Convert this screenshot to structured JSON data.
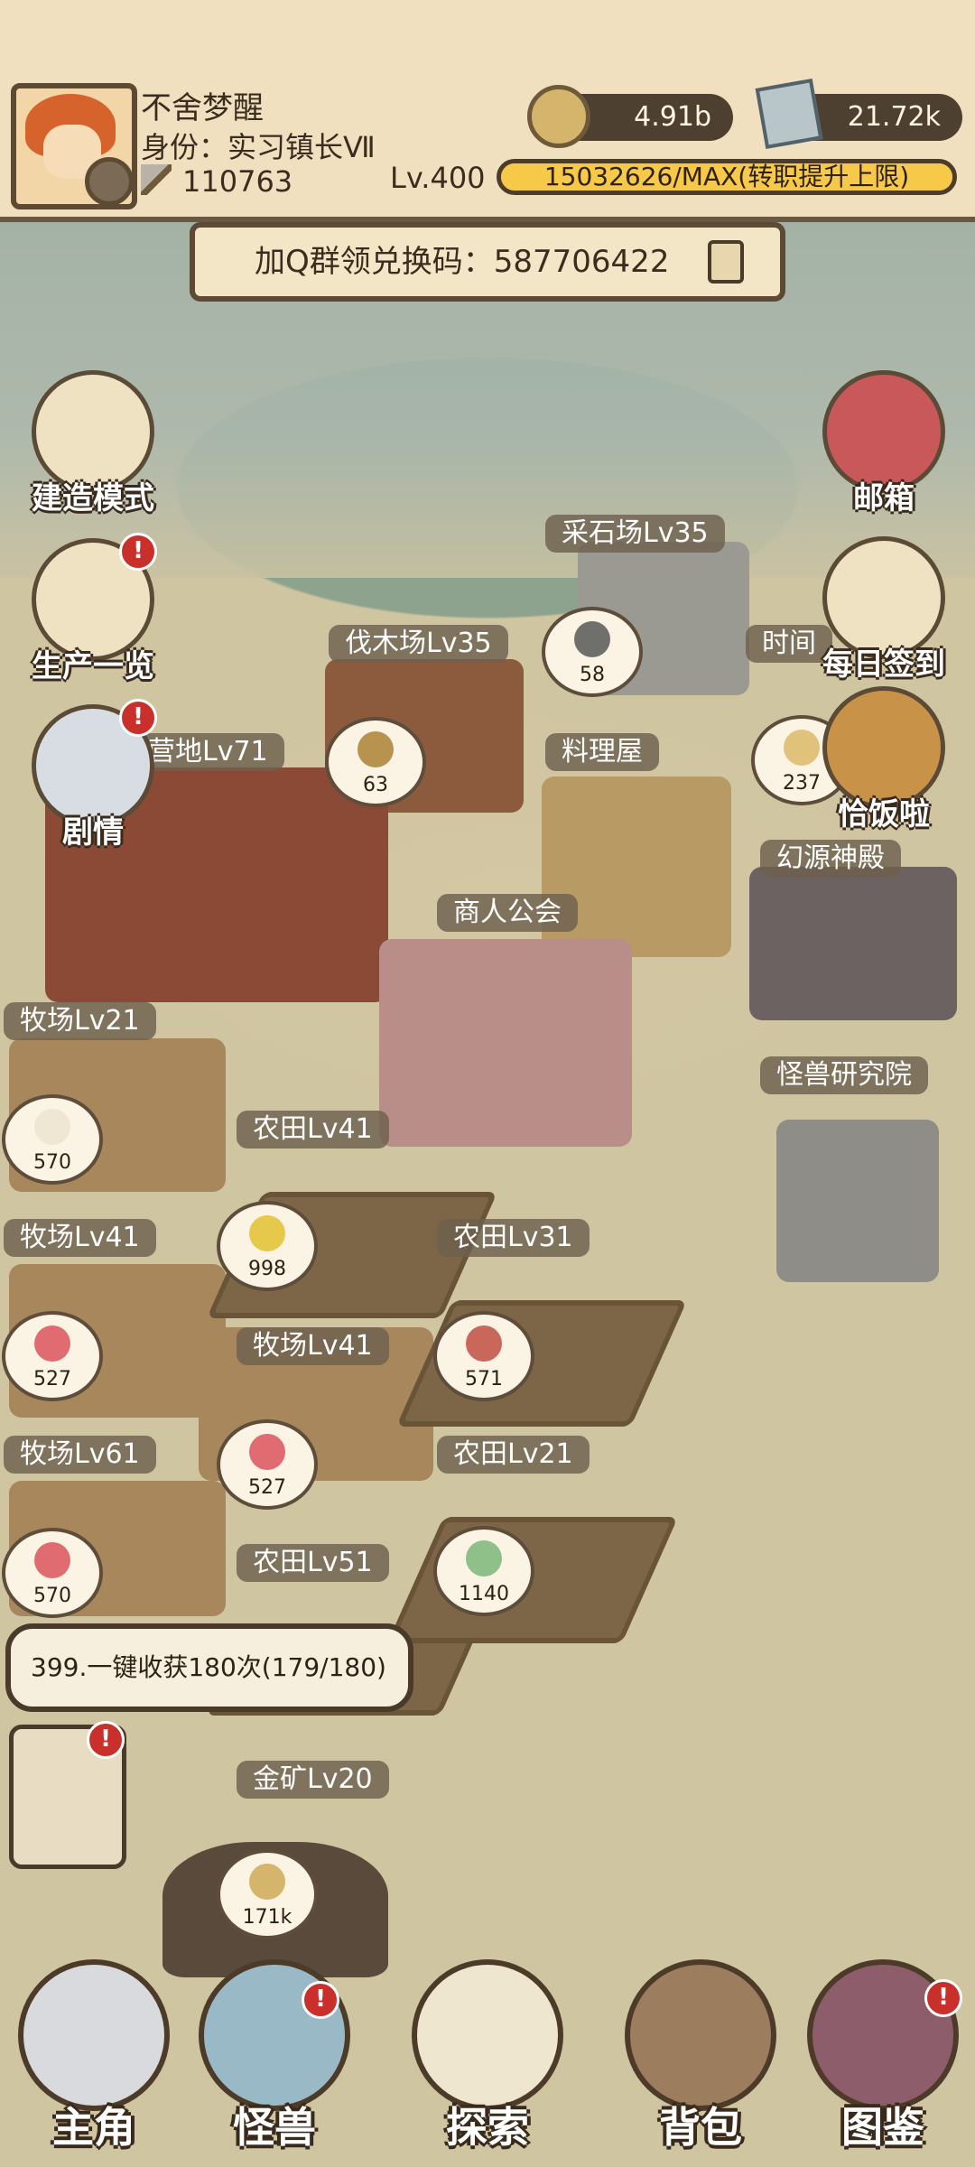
{
  "header": {
    "player_name": "不舍梦醒",
    "player_title": "身份：实习镇长Ⅶ",
    "power": "110763",
    "level": "Lv.400",
    "exp_text": "15032626/MAX(转职提升上限)",
    "exp_progress": 1.0,
    "currency": [
      {
        "name": "coin",
        "icon": "coin-icon",
        "value": "4.91b"
      },
      {
        "name": "gem",
        "icon": "crystal-icon",
        "value": "21.72k"
      }
    ]
  },
  "banner": {
    "text": "加Q群领兑换码：587706422",
    "icon": "copy-icon"
  },
  "side_buttons": {
    "build": "建造模式",
    "production": "生产一览",
    "story": "剧情",
    "mail": "邮箱",
    "daily": "每日签到",
    "meal": "恰饭啦"
  },
  "buildings": {
    "quarry": "采石场Lv35",
    "lumber": "伐木场Lv35",
    "time": "时间",
    "camp": "营地Lv71",
    "kitchen": "料理屋",
    "temple": "幻源神殿",
    "merchant": "商人公会",
    "ranch1": "牧场Lv21",
    "lab": "怪兽研究院",
    "farm1": "农田Lv41",
    "ranch2": "牧场Lv41",
    "farm2": "农田Lv31",
    "ranch3": "牧场Lv41",
    "ranch4": "牧场Lv61",
    "farm3": "农田Lv21",
    "farm4": "农田Lv51",
    "goldmine": "金矿Lv20"
  },
  "bubbles": {
    "stone": "58",
    "wood": "63",
    "kitchen": "237",
    "milk": "570",
    "corn": "998",
    "meat1": "527",
    "steak": "571",
    "meat2": "527",
    "meat3": "570",
    "herb": "1140",
    "gold": "171k"
  },
  "tip": {
    "text": "399.一键收获180次(179/180)"
  },
  "bottom_nav": {
    "hero": "主角",
    "monster": "怪兽",
    "explore": "探索",
    "bag": "背包",
    "codex": "图鉴"
  },
  "badges": {
    "alert": "!"
  },
  "colors": {
    "label_bg": "#6e604e",
    "badge_red": "#c9302c",
    "header_bg": "#f0e0c0",
    "exp_gold": "#f6c948"
  }
}
